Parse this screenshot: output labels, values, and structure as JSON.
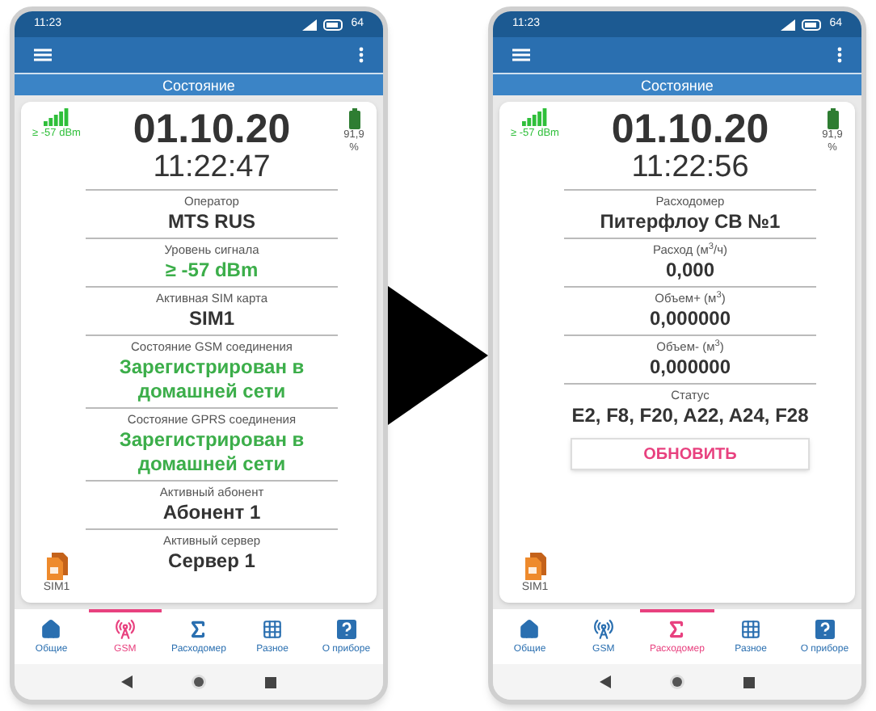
{
  "phones": [
    {
      "status_bar": {
        "time": "11:23",
        "battery": "64"
      },
      "title": "Состояние",
      "signal_text": "≥ -57 dBm",
      "battery_text": "91,9 %",
      "date": "01.10.20",
      "time": "11:22:47",
      "fields": [
        {
          "label": "Оператор",
          "value": "MTS RUS",
          "kind": "plain"
        },
        {
          "label": "Уровень сигнала",
          "value": "≥ -57 dBm",
          "kind": "highlight"
        },
        {
          "label": "Активная SIM карта",
          "value": "SIM1",
          "kind": "plain"
        },
        {
          "label": "Состояние GSM соединения",
          "value": "Зарегистрирован в домашней сети",
          "kind": "highlight"
        },
        {
          "label": "Состояние GPRS соединения",
          "value": "Зарегистрирован в домашней сети",
          "kind": "highlight"
        },
        {
          "label": "Активный абонент",
          "value": "Абонент 1",
          "kind": "plain"
        },
        {
          "label": "Активный сервер",
          "value": "Сервер 1",
          "kind": "plain"
        }
      ],
      "sim_label": "SIM1",
      "nav": [
        {
          "label": "Общие",
          "selected": false,
          "kind": "home"
        },
        {
          "label": "GSM",
          "selected": true,
          "kind": "antenna"
        },
        {
          "label": "Расходомер",
          "selected": false,
          "kind": "sigma"
        },
        {
          "label": "Разное",
          "selected": false,
          "kind": "grid"
        },
        {
          "label": "О приборе",
          "selected": false,
          "kind": "help"
        }
      ]
    },
    {
      "status_bar": {
        "time": "11:23",
        "battery": "64"
      },
      "title": "Состояние",
      "signal_text": "≥ -57 dBm",
      "battery_text": "91,9 %",
      "date": "01.10.20",
      "time": "11:22:56",
      "fields": [
        {
          "label": "Расходомер",
          "value": "Питерфлоу СВ №1",
          "kind": "plain"
        },
        {
          "label": "Расход (м$^{3}$/ч)",
          "value": "0,000",
          "kind": "plain"
        },
        {
          "label": "Объем+ (м$^{3}$)",
          "value": "0,000000",
          "kind": "plain"
        },
        {
          "label": "Объем- (м$^{3}$)",
          "value": "0,000000",
          "kind": "plain"
        },
        {
          "label": "Статус",
          "value": "E2, F8, F20, A22, A24, F28",
          "kind": "plain"
        }
      ],
      "button": "ОБНОВИТЬ",
      "sim_label": "SIM1",
      "nav": [
        {
          "label": "Общие",
          "selected": false,
          "kind": "home"
        },
        {
          "label": "GSM",
          "selected": false,
          "kind": "antenna"
        },
        {
          "label": "Расходомер",
          "selected": true,
          "kind": "sigma"
        },
        {
          "label": "Разное",
          "selected": false,
          "kind": "grid"
        },
        {
          "label": "О приборе",
          "selected": false,
          "kind": "help"
        }
      ]
    }
  ]
}
